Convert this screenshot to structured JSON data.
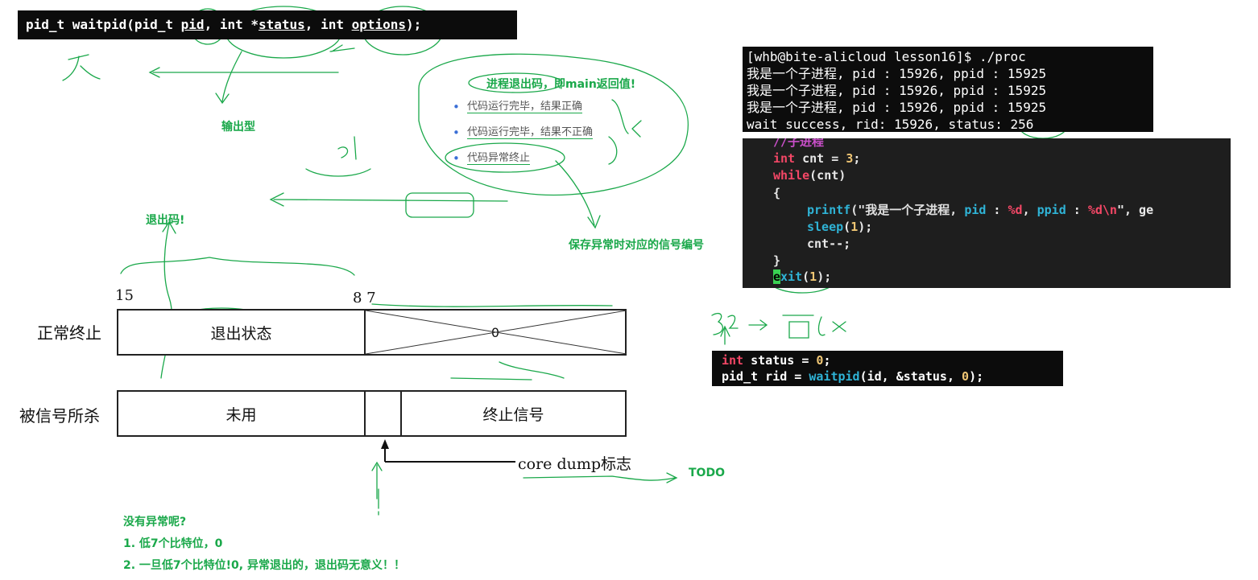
{
  "prototype": {
    "prefix": "pid_t waitpid(pid_t ",
    "arg1": "pid",
    "sep1": ", int *",
    "arg2": "status",
    "sep2": ", int ",
    "arg3": "options",
    "suffix": ");"
  },
  "annotations": {
    "output_param": "输出型",
    "exit_code_title": "进程退出码，即main返回值!",
    "exit_code_short": "退出码!",
    "signal_note": "保存异常时对应的信号编号",
    "todo": "TODO",
    "no_exception_title": "没有异常呢?",
    "no_exception_1": "1. 低7个比特位，0",
    "no_exception_2": "2. 一旦低7个比特位!0, 异常退出的，退出码无意义！！"
  },
  "exit_cases": [
    "代码运行完毕，结果正确",
    "代码运行完毕，结果不正确",
    "代码异常终止"
  ],
  "bit_diagram": {
    "bit_15": "15",
    "bit_8_7": "8 7",
    "row_normal_label": "正常终止",
    "row_normal_high": "退出状态",
    "row_normal_low": "0",
    "row_signal_label": "被信号所杀",
    "row_signal_high": "未用",
    "row_signal_low": "终止信号",
    "core_dump": "core dump标志"
  },
  "terminal": {
    "lines": [
      "[whb@bite-alicloud lesson16]$ ./proc",
      "我是一个子进程, pid : 15926, ppid : 15925",
      "我是一个子进程, pid : 15926, ppid : 15925",
      "我是一个子进程, pid : 15926, ppid : 15925"
    ],
    "last_prefix": "wait success, rid: 15926, status: ",
    "last_status": "256"
  },
  "editor": {
    "comment": "//子进程",
    "l1_kw": "int",
    "l1_rest": " cnt = ",
    "l1_num": "3",
    "l1_end": ";",
    "l2_kw": "while",
    "l2_rest": "(cnt)",
    "l3": "{",
    "l4_fn": "printf",
    "l4_str": "(\"我是一个子进程, ",
    "l4_a": "pid",
    "l4_b": " : ",
    "l4_c": "%d",
    "l4_d": ", ",
    "l4_e": "ppid",
    "l4_f": " : ",
    "l4_g": "%d\\n",
    "l4_h": "\", ge",
    "l5_fn": "sleep",
    "l5_open": "(",
    "l5_num": "1",
    "l5_close": ");",
    "l6": "cnt--;",
    "l7": "}",
    "l8_cursor": "e",
    "l8_fn": "xit",
    "l8_open": "(",
    "l8_num": "1",
    "l8_close": ");"
  },
  "snippet": {
    "l1_kw": "int",
    "l1_rest": " status = ",
    "l1_num": "0",
    "l1_end": ";",
    "l2_a": "pid_t rid = ",
    "l2_fn": "waitpid",
    "l2_b": "(id, &status, ",
    "l2_num": "0",
    "l2_end": ");"
  },
  "colors": {
    "annotation_green": "#1aa84a",
    "terminal_bg": "#0c0c0c",
    "editor_bg": "#1e1e1e",
    "keyword": "#f44766",
    "function": "#2fb3d6",
    "number": "#f0c674"
  }
}
